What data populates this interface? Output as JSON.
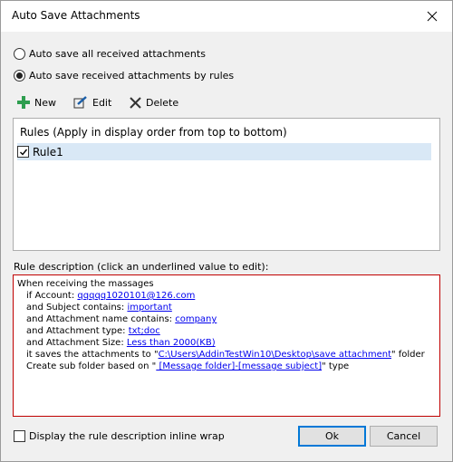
{
  "window": {
    "title": "Auto Save Attachments"
  },
  "options": {
    "all_label": "Auto save all received attachments",
    "by_rules_label": "Auto save received attachments by rules",
    "selected": "by_rules"
  },
  "toolbar": {
    "new_label": "New",
    "edit_label": "Edit",
    "delete_label": "Delete"
  },
  "rules": {
    "header": "Rules (Apply in display order from top to bottom)",
    "items": [
      {
        "label": "Rule1",
        "checked": true,
        "selected": true
      }
    ]
  },
  "description": {
    "label": "Rule description (click an underlined value to edit):",
    "line1": "When receiving the massages",
    "account_prefix": "if Account: ",
    "account_value": "qqqqq1020101@126.com",
    "subject_prefix": "and Subject contains: ",
    "subject_value": "important",
    "attname_prefix": "and Attachment name contains: ",
    "attname_value": "company",
    "atttype_prefix": "and Attachment type: ",
    "atttype_value": "txt;doc",
    "attsize_prefix": "and Attachment Size: ",
    "attsize_value": "Less than 2000(KB)",
    "saves_prefix": "it saves the attachments to \"",
    "saves_value": "C:\\Users\\AddinTestWin10\\Desktop\\save attachment",
    "saves_suffix": "\" folder",
    "subfolder_prefix": "Create sub folder based on \"",
    "subfolder_value": " [Message folder]-[message subject]",
    "subfolder_suffix": "\" type"
  },
  "footer": {
    "wrap_label": "Display the rule description inline wrap",
    "ok_label": "Ok",
    "cancel_label": "Cancel"
  },
  "colors": {
    "accent": "#0078d7",
    "selected_row": "#d9e8f6",
    "desc_border": "#c00000",
    "link": "#0000ee",
    "new_icon": "#2e9e4f"
  }
}
